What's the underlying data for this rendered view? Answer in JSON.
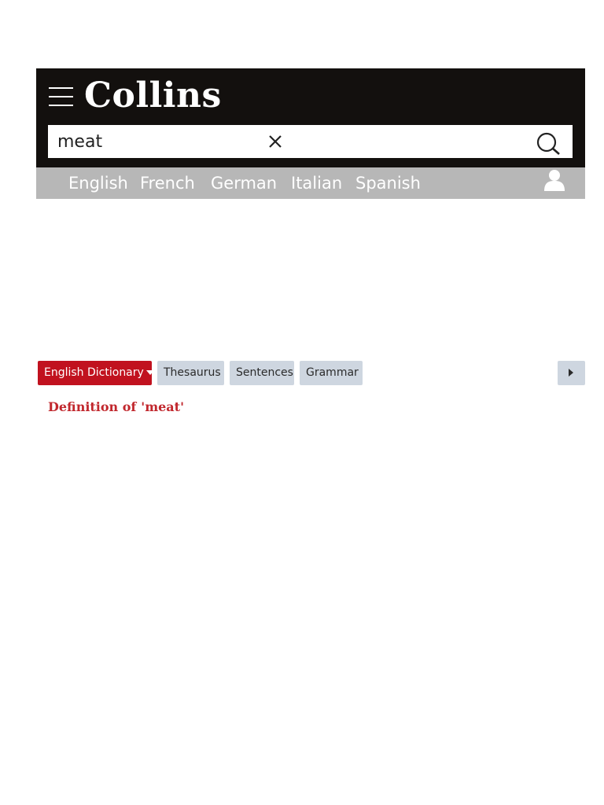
{
  "header": {
    "logo": "Collins"
  },
  "search": {
    "value": "meat",
    "placeholder": ""
  },
  "languages": [
    "English",
    "French",
    "German",
    "Italian",
    "Spanish"
  ],
  "tabs": {
    "dictionary": "English Dictionary",
    "thesaurus": "Thesaurus",
    "sentences": "Sentences",
    "grammar": "Grammar"
  },
  "definition": {
    "prefix": "Definition of",
    "term": "'meat'"
  },
  "icons": {
    "menu": "menu-icon",
    "clear": "close-icon",
    "search": "search-icon",
    "user": "user-icon",
    "dropdown": "caret-down-icon",
    "scroll": "chevron-right-icon"
  },
  "colors": {
    "header_bg": "#13100e",
    "lang_bar_bg": "#b7b7b7",
    "accent_red": "#c1121f",
    "tab_bg": "#ced6e0",
    "definition_red": "#c1272d"
  }
}
